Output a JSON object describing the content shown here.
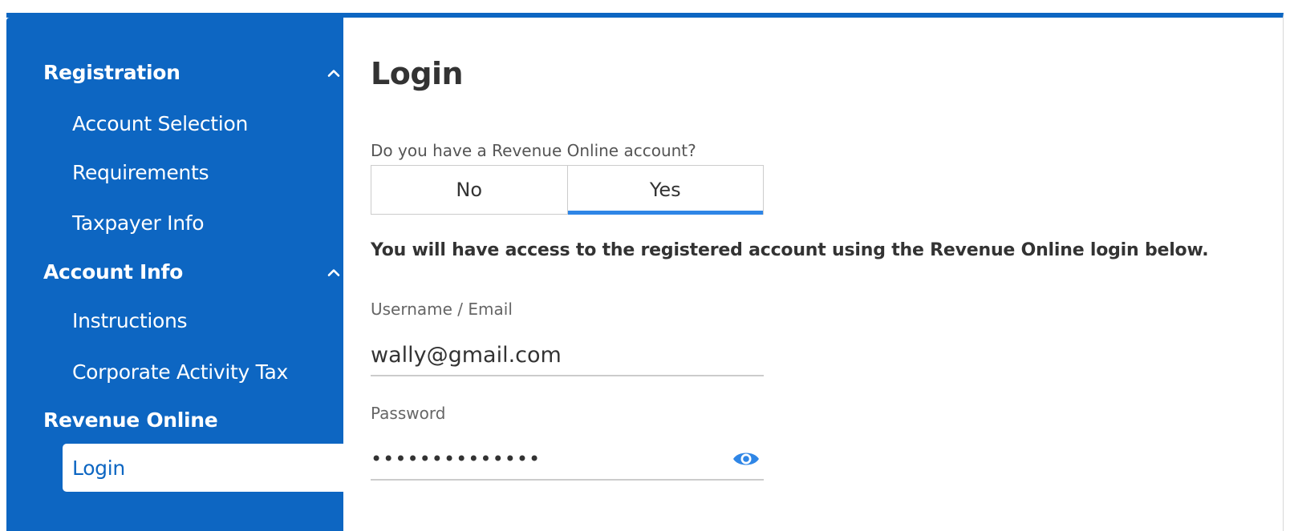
{
  "sidebar": {
    "sections": [
      {
        "label": "Registration",
        "items": [
          "Account Selection",
          "Requirements",
          "Taxpayer Info"
        ]
      },
      {
        "label": "Account Info",
        "items": [
          "Instructions",
          "Corporate Activity Tax"
        ]
      },
      {
        "label": "Revenue Online",
        "items": [
          "Login"
        ]
      }
    ],
    "active_item": "Login",
    "icons": {
      "collapse": "chevron-up-icon"
    }
  },
  "main": {
    "title": "Login",
    "question": "Do you have a Revenue Online account?",
    "toggle": {
      "options": [
        "No",
        "Yes"
      ],
      "selected": "Yes"
    },
    "notice": "You will have access to the registered account using the Revenue Online login below.",
    "username": {
      "label": "Username / Email",
      "value": "wally@gmail.com"
    },
    "password": {
      "label": "Password",
      "masked_value": "••••••••••••••",
      "icon": "eye-icon"
    }
  },
  "colors": {
    "brand": "#0d66c2",
    "accent": "#2f86e6",
    "text": "#333333",
    "border": "#cccccc"
  }
}
